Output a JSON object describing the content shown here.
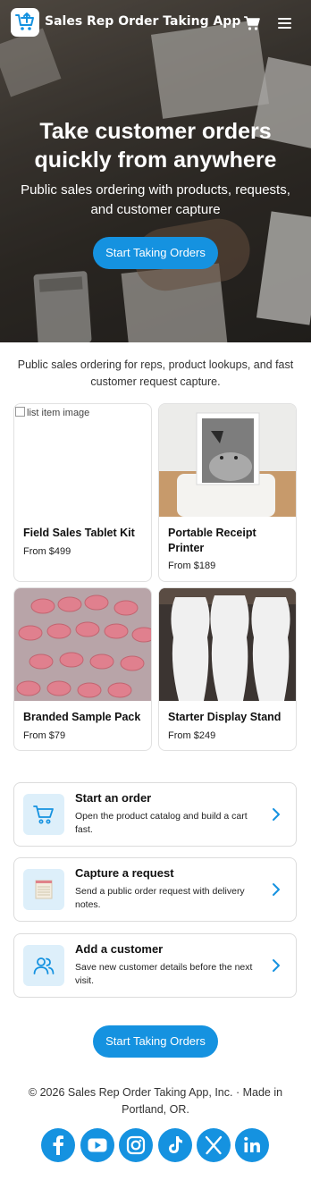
{
  "header": {
    "app_title": "Sales Rep Order Taking App",
    "logo_icon": "cart-upload-logo-icon",
    "cart_icon": "cart-icon",
    "menu_icon": "hamburger-menu-icon"
  },
  "hero": {
    "title": "Take customer orders quickly from anywhere",
    "subtitle": "Public sales ordering with products, requests, and customer capture",
    "cta_label": "Start Taking Orders"
  },
  "intro": "Public sales ordering for reps, product lookups, and fast customer request capture.",
  "products": [
    {
      "name": "Field Sales Tablet Kit",
      "price": "From $499",
      "image_alt": "list item image"
    },
    {
      "name": "Portable Receipt Printer",
      "price": "From $189"
    },
    {
      "name": "Branded Sample Pack",
      "price": "From $79"
    },
    {
      "name": "Starter Display Stand",
      "price": "From $249"
    }
  ],
  "actions": [
    {
      "title": "Start an order",
      "desc": "Open the product catalog and build a cart fast.",
      "icon": "cart-icon"
    },
    {
      "title": "Capture a request",
      "desc": "Send a public order request with delivery notes.",
      "icon": "notepad-icon"
    },
    {
      "title": "Add a customer",
      "desc": "Save new customer details before the next visit.",
      "icon": "users-icon"
    }
  ],
  "bottom_cta": "Start Taking Orders",
  "footer": "© 2026 Sales Rep Order Taking App, Inc. · Made in Portland, OR.",
  "social": [
    "facebook-icon",
    "youtube-icon",
    "instagram-icon",
    "tiktok-icon",
    "x-icon",
    "linkedin-icon"
  ],
  "colors": {
    "accent": "#1592e0",
    "icon_bg": "#ddeffa"
  }
}
